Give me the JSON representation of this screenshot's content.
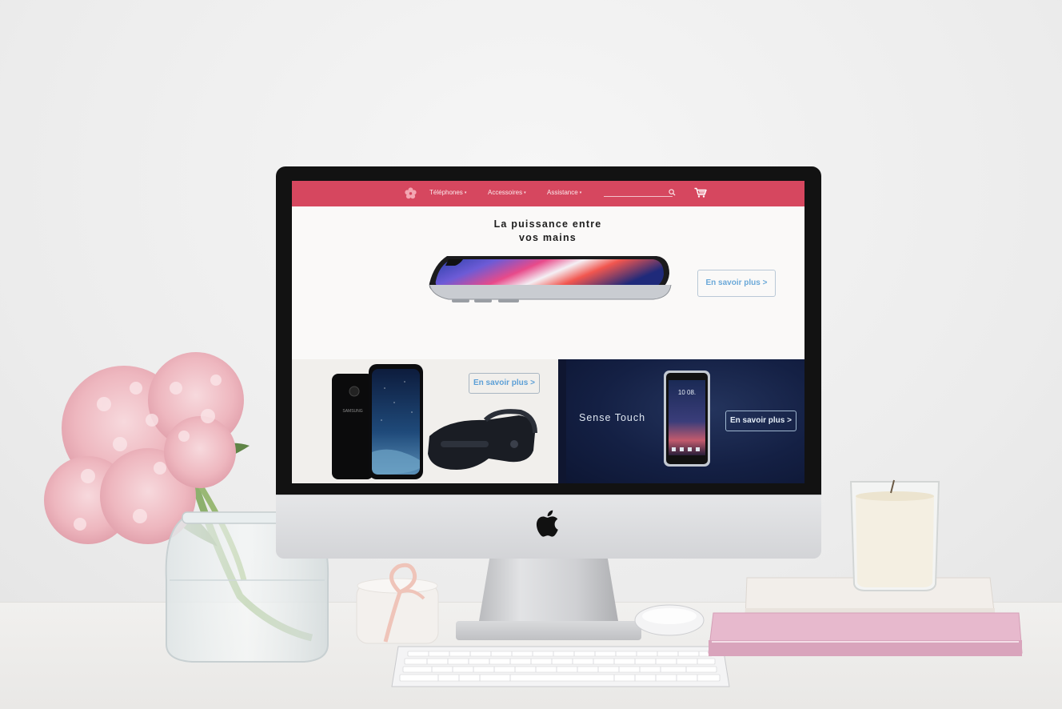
{
  "nav": {
    "items": [
      {
        "label": "Téléphones"
      },
      {
        "label": "Accessoires"
      },
      {
        "label": "Assistance"
      }
    ],
    "caret": "▾",
    "search_placeholder": "",
    "accent_color": "#d6475f"
  },
  "hero": {
    "title_line1": "La puissance entre",
    "title_line2": "vos mains",
    "cta_label": "En savoir plus >"
  },
  "promo_left": {
    "cta_label": "En savoir plus >",
    "brand_text": "SAMSUNG"
  },
  "promo_right": {
    "title": "Sense Touch",
    "cta_label": "En savoir plus >",
    "phone_time": "10 08."
  },
  "icons": {
    "logo": "flower-logo-icon",
    "search": "search-icon",
    "cart": "cart-icon"
  }
}
